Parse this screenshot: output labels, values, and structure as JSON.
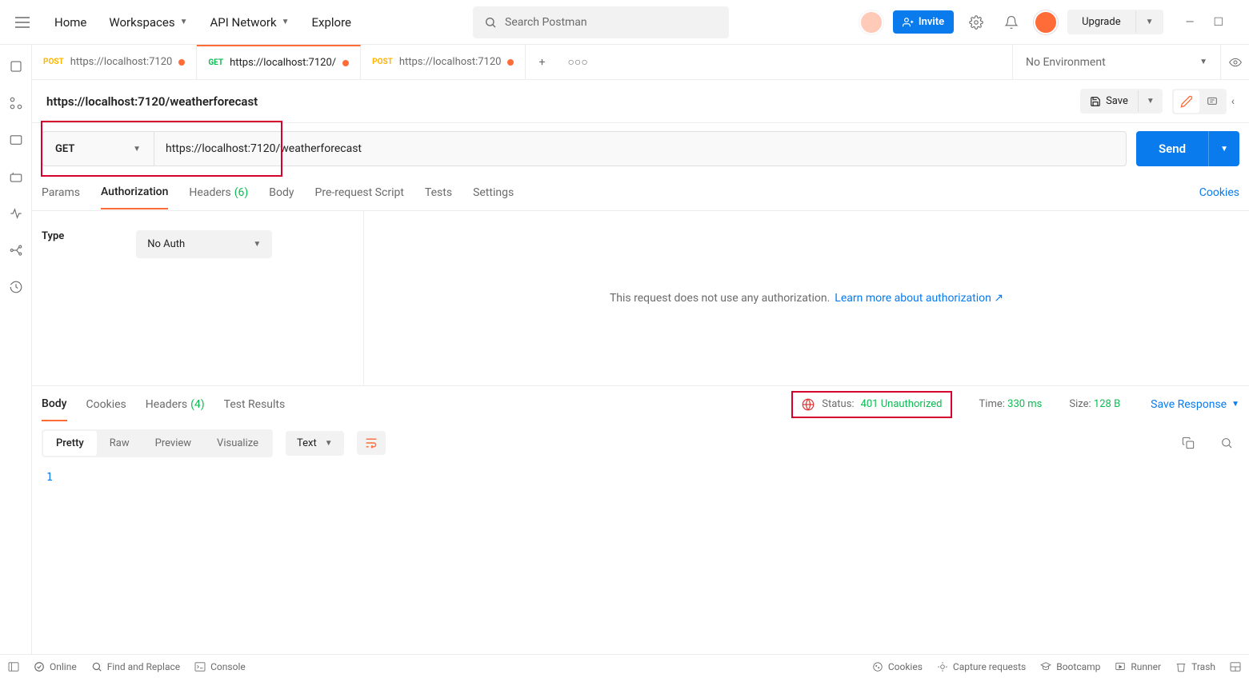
{
  "header": {
    "home": "Home",
    "workspaces": "Workspaces",
    "api_network": "API Network",
    "explore": "Explore",
    "search_placeholder": "Search Postman",
    "invite": "Invite",
    "upgrade": "Upgrade"
  },
  "tabs": [
    {
      "method": "POST",
      "label": "https://localhost:7120",
      "modified": true,
      "active": false
    },
    {
      "method": "GET",
      "label": "https://localhost:7120/",
      "modified": true,
      "active": true
    },
    {
      "method": "POST",
      "label": "https://localhost:7120",
      "modified": true,
      "active": false
    }
  ],
  "environment": {
    "selected": "No Environment"
  },
  "request": {
    "title": "https://localhost:7120/weatherforecast",
    "method": "GET",
    "url": "https://localhost:7120/weatherforecast",
    "save": "Save",
    "send": "Send",
    "tabs": {
      "params": "Params",
      "authorization": "Authorization",
      "headers": "Headers",
      "headers_count": "(6)",
      "body": "Body",
      "pre_request": "Pre-request Script",
      "tests": "Tests",
      "settings": "Settings",
      "cookies": "Cookies"
    },
    "auth": {
      "type_label": "Type",
      "type_value": "No Auth",
      "message": "This request does not use any authorization.",
      "learn_more": "Learn more about authorization"
    }
  },
  "response": {
    "tabs": {
      "body": "Body",
      "cookies": "Cookies",
      "headers": "Headers",
      "headers_count": "(4)",
      "test_results": "Test Results"
    },
    "status_label": "Status:",
    "status_value": "401 Unauthorized",
    "time_label": "Time:",
    "time_value": "330 ms",
    "size_label": "Size:",
    "size_value": "128 B",
    "save_response": "Save Response",
    "view_tabs": {
      "pretty": "Pretty",
      "raw": "Raw",
      "preview": "Preview",
      "visualize": "Visualize"
    },
    "format": "Text",
    "line1": "1"
  },
  "footer": {
    "online": "Online",
    "find": "Find and Replace",
    "console": "Console",
    "cookies": "Cookies",
    "capture": "Capture requests",
    "bootcamp": "Bootcamp",
    "runner": "Runner",
    "trash": "Trash"
  }
}
